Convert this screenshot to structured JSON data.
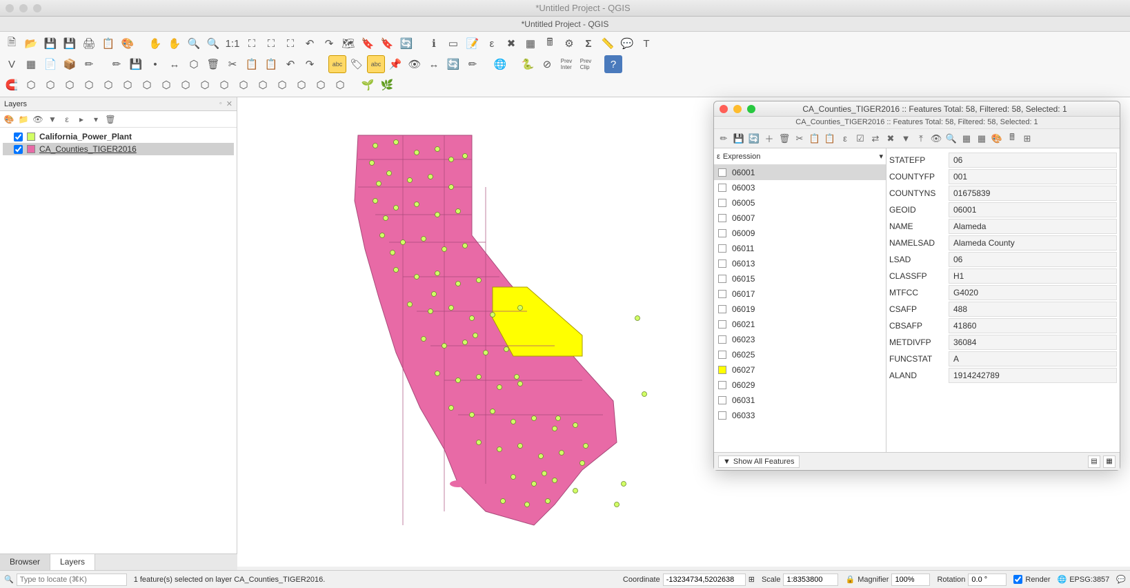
{
  "window": {
    "title": "*Untitled Project - QGIS",
    "subtitle": "*Untitled Project - QGIS"
  },
  "layers_panel": {
    "title": "Layers",
    "items": [
      {
        "name": "California_Power_Plant",
        "checked": true,
        "color": "#d2ff66",
        "bold": true,
        "underline": false,
        "selected": false
      },
      {
        "name": "CA_Counties_TIGER2016",
        "checked": true,
        "color": "#e86aa6",
        "bold": false,
        "underline": true,
        "selected": true
      }
    ]
  },
  "bottom_tabs": {
    "browser": "Browser",
    "layers": "Layers"
  },
  "statusbar": {
    "locator_placeholder": "Type to locate (⌘K)",
    "selection_msg": "1 feature(s) selected on layer CA_Counties_TIGER2016.",
    "coord_label": "Coordinate",
    "coord_value": "-13234734,5202638",
    "scale_label": "Scale",
    "scale_value": "1:8353800",
    "magnifier_label": "Magnifier",
    "magnifier_value": "100%",
    "rotation_label": "Rotation",
    "rotation_value": "0.0 °",
    "render_label": "Render",
    "crs": "EPSG:3857"
  },
  "attr_window": {
    "title": "CA_Counties_TIGER2016 :: Features Total: 58, Filtered: 58, Selected: 1",
    "subtitle": "CA_Counties_TIGER2016 :: Features Total: 58, Filtered: 58, Selected: 1",
    "expression_label": "Expression",
    "show_all": "Show All Features",
    "features": [
      {
        "id": "06001",
        "selected": true
      },
      {
        "id": "06003"
      },
      {
        "id": "06005"
      },
      {
        "id": "06007"
      },
      {
        "id": "06009"
      },
      {
        "id": "06011"
      },
      {
        "id": "06013"
      },
      {
        "id": "06015"
      },
      {
        "id": "06017"
      },
      {
        "id": "06019"
      },
      {
        "id": "06021"
      },
      {
        "id": "06023"
      },
      {
        "id": "06025"
      },
      {
        "id": "06027",
        "highlighted": true
      },
      {
        "id": "06029"
      },
      {
        "id": "06031"
      },
      {
        "id": "06033"
      }
    ],
    "form": [
      {
        "label": "STATEFP",
        "value": "06"
      },
      {
        "label": "COUNTYFP",
        "value": "001"
      },
      {
        "label": "COUNTYNS",
        "value": "01675839"
      },
      {
        "label": "GEOID",
        "value": "06001"
      },
      {
        "label": "NAME",
        "value": "Alameda"
      },
      {
        "label": "NAMELSAD",
        "value": "Alameda County"
      },
      {
        "label": "LSAD",
        "value": "06"
      },
      {
        "label": "CLASSFP",
        "value": "H1"
      },
      {
        "label": "MTFCC",
        "value": "G4020"
      },
      {
        "label": "CSAFP",
        "value": "488"
      },
      {
        "label": "CBSAFP",
        "value": "41860"
      },
      {
        "label": "METDIVFP",
        "value": "36084"
      },
      {
        "label": "FUNCSTAT",
        "value": "A"
      },
      {
        "label": "ALAND",
        "value": "1914242789"
      }
    ]
  },
  "map": {
    "fill": "#e86aa6",
    "highlight": "#ffff00",
    "point": "#d2ff66"
  }
}
